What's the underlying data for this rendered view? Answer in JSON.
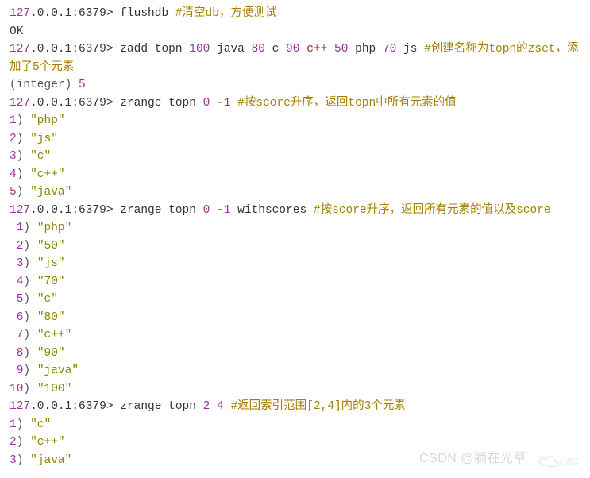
{
  "prompt": {
    "ip": "127",
    "rest": ".0.0.1:6379> "
  },
  "cmd1": {
    "command": "flushdb ",
    "comment": "#清空db，方便测试"
  },
  "line_ok": "OK",
  "cmd2": {
    "pre": "zadd topn ",
    "v1": "100",
    "s1": " java ",
    "v2": "80",
    "s2": " c ",
    "v3": "90",
    "cpp": " c++ ",
    "v4": "50",
    "s4": " php ",
    "v5": "70",
    "s5": " js ",
    "comment": "#创建名称为topn的zset，添加了5个元素"
  },
  "line_integer_open": "(integer) ",
  "line_integer_val": "5",
  "cmd3": {
    "pre": "zrange topn ",
    "a": "0",
    "sp": " -",
    "b": "1",
    "tail": " ",
    "comment": "#按score升序，返回topn中所有元素的值"
  },
  "list3": [
    {
      "i": "1",
      "p": ") ",
      "v": "\"php\""
    },
    {
      "i": "2",
      "p": ") ",
      "v": "\"js\""
    },
    {
      "i": "3",
      "p": ") ",
      "v": "\"c\""
    },
    {
      "i": "4",
      "p": ") ",
      "v": "\"c++\""
    },
    {
      "i": "5",
      "p": ") ",
      "v": "\"java\""
    }
  ],
  "cmd4": {
    "pre": "zrange topn ",
    "a": "0",
    "sp": " -",
    "b": "1",
    "tail": " withscores ",
    "comment": "#按score升序，返回所有元素的值以及score"
  },
  "list4": [
    {
      "i": " 1",
      "p": ") ",
      "v": "\"php\""
    },
    {
      "i": " 2",
      "p": ") ",
      "v": "\"50\""
    },
    {
      "i": " 3",
      "p": ") ",
      "v": "\"js\""
    },
    {
      "i": " 4",
      "p": ") ",
      "v": "\"70\""
    },
    {
      "i": " 5",
      "p": ") ",
      "v": "\"c\""
    },
    {
      "i": " 6",
      "p": ") ",
      "v": "\"80\""
    },
    {
      "i": " 7",
      "p": ") ",
      "v": "\"c++\""
    },
    {
      "i": " 8",
      "p": ") ",
      "v": "\"90\""
    },
    {
      "i": " 9",
      "p": ") ",
      "v": "\"java\""
    },
    {
      "i": "10",
      "p": ") ",
      "v": "\"100\""
    }
  ],
  "cmd5": {
    "pre": "zrange topn ",
    "a": "2",
    "sp": " ",
    "b": "4",
    "tail": " ",
    "comment": "#返回索引范围[2,4]内的3个元素"
  },
  "list5": [
    {
      "i": "1",
      "p": ") ",
      "v": "\"c\""
    },
    {
      "i": "2",
      "p": ") ",
      "v": "\"c++\""
    },
    {
      "i": "3",
      "p": ") ",
      "v": "\"java\""
    }
  ],
  "watermark": "CSDN @躺在光草",
  "logo_text": "亿速云"
}
